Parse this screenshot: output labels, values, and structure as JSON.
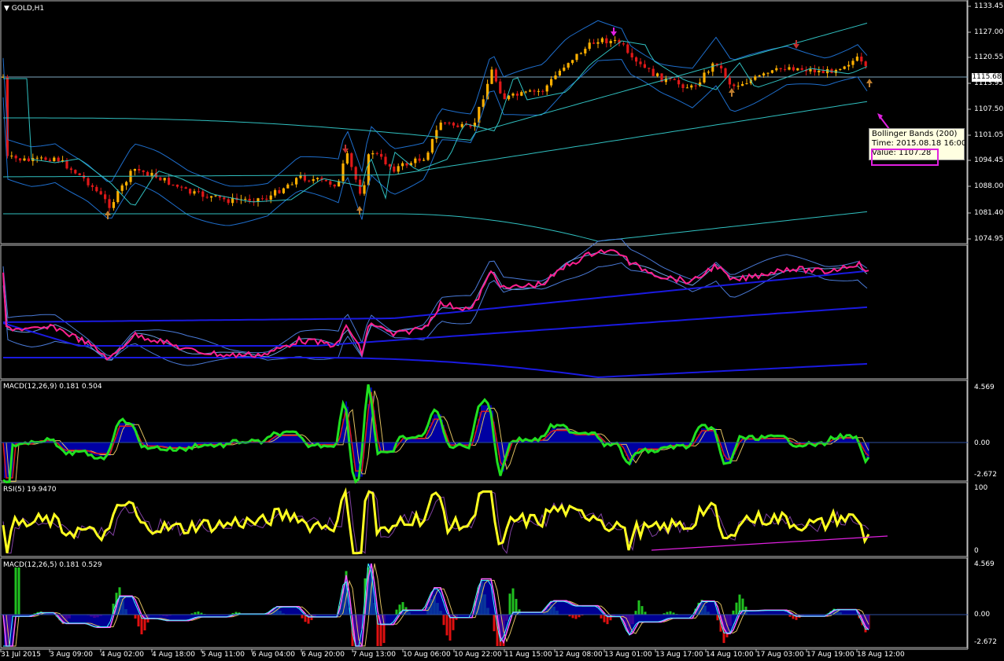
{
  "symbol": "GOLD,H1",
  "price_axis": [
    "1133.45",
    "1127.00",
    "1120.55",
    "1113.95",
    "1107.50",
    "1101.05",
    "1094.45",
    "1088.00",
    "1081.40",
    "1074.95"
  ],
  "current_price": "1115.68",
  "tooltip": {
    "title": "Bollinger Bands (200)",
    "time": "Time: 2015.08.18 16:00",
    "value": "Value: 1107.28"
  },
  "macd1": {
    "label": "MACD(12,26,9) 0.181 0.504",
    "top": "4.569",
    "zero": "0.00",
    "bottom": "-2.672"
  },
  "rsi": {
    "label": "RSI(5) 19.9470",
    "top": "100",
    "bottom": "0"
  },
  "macd2": {
    "label": "MACD(12,26,5) 0.181 0.529",
    "top": "4.569",
    "zero": "0.00",
    "bottom": "-2.672"
  },
  "time_axis": [
    "31 Jul 2015",
    "3 Aug 09:00",
    "4 Aug 02:00",
    "4 Aug 18:00",
    "5 Aug 11:00",
    "6 Aug 04:00",
    "6 Aug 20:00",
    "7 Aug 13:00",
    "10 Aug 06:00",
    "10 Aug 22:00",
    "11 Aug 15:00",
    "12 Aug 08:00",
    "13 Aug 01:00",
    "13 Aug 17:00",
    "14 Aug 10:00",
    "17 Aug 03:00",
    "17 Aug 19:00",
    "18 Aug 12:00"
  ],
  "colors": {
    "up": "#ffb000",
    "down": "#e01818",
    "bb_outer": "#30c0c0",
    "bb_inner": "#1e6ecc",
    "blue": "#1a1ae0",
    "pink": "#ff2090",
    "green": "#20e020",
    "yellow": "#ffff20",
    "hist_blue": "#0000cc",
    "hist_red": "#e01010",
    "hist_green": "#20c020"
  }
}
